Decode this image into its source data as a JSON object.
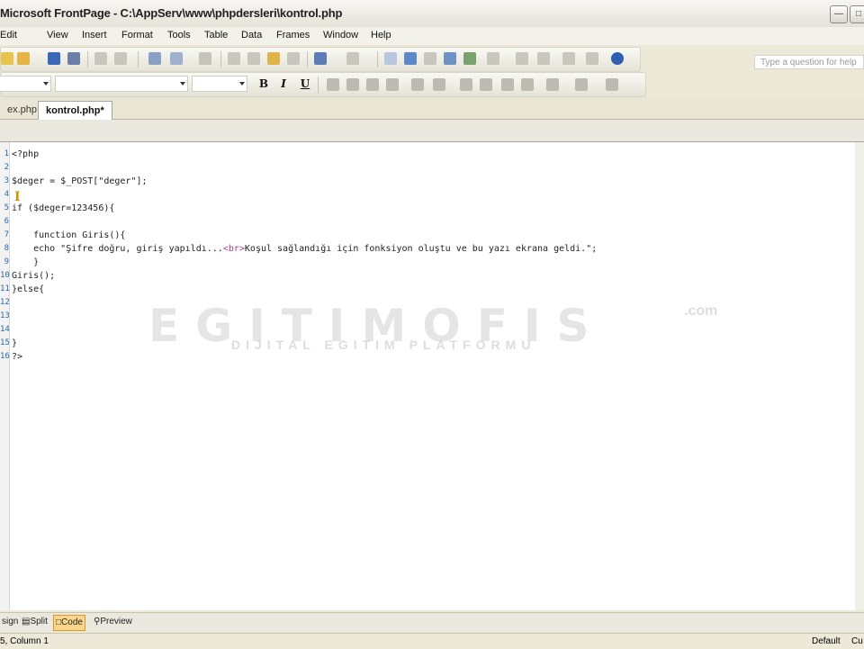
{
  "window": {
    "title": "Microsoft FrontPage - C:\\AppServ\\www\\phpdersleri\\kontrol.php"
  },
  "menu": [
    "Edit",
    "View",
    "Insert",
    "Format",
    "Tools",
    "Table",
    "Data",
    "Frames",
    "Window",
    "Help"
  ],
  "help_placeholder": "Type a question for help",
  "format_buttons": {
    "bold": "B",
    "italic": "I",
    "underline": "U"
  },
  "tabs": [
    {
      "label": "ex.php"
    },
    {
      "label": "kontrol.php*"
    }
  ],
  "code": {
    "lines": [
      {
        "num": "1",
        "text": "<?php"
      },
      {
        "num": "2",
        "text": ""
      },
      {
        "num": "3",
        "text": "$deger = $_POST[\"deger\"];"
      },
      {
        "num": "4",
        "text": ""
      },
      {
        "num": "5",
        "text": "if ($deger=123456){"
      },
      {
        "num": "6",
        "text": ""
      },
      {
        "num": "7",
        "text": "    function Giris(){"
      },
      {
        "num": "8",
        "pre": "    echo \"Şifre doğru, giriş yapıldı...",
        "tag": "<br>",
        "post": "Koşul sağlandığı için fonksiyon oluştu ve bu yazı ekrana geldi.\";"
      },
      {
        "num": "9",
        "text": "    }"
      },
      {
        "num": "10",
        "text": "Giris();"
      },
      {
        "num": "11",
        "text": "}else{"
      },
      {
        "num": "12",
        "text": ""
      },
      {
        "num": "13",
        "text": ""
      },
      {
        "num": "14",
        "text": ""
      },
      {
        "num": "15",
        "text": "}"
      },
      {
        "num": "16",
        "text": "?>"
      }
    ]
  },
  "watermark": {
    "main": "EGITIMOFIS",
    "suffix": ".com",
    "sub": "DIJITAL EGITIM PLATFORMU"
  },
  "view_tabs": [
    "sign",
    "Split",
    "Code",
    "Preview"
  ],
  "status": {
    "position": "5, Column 1",
    "mode": "Default",
    "extra": "Cu"
  }
}
